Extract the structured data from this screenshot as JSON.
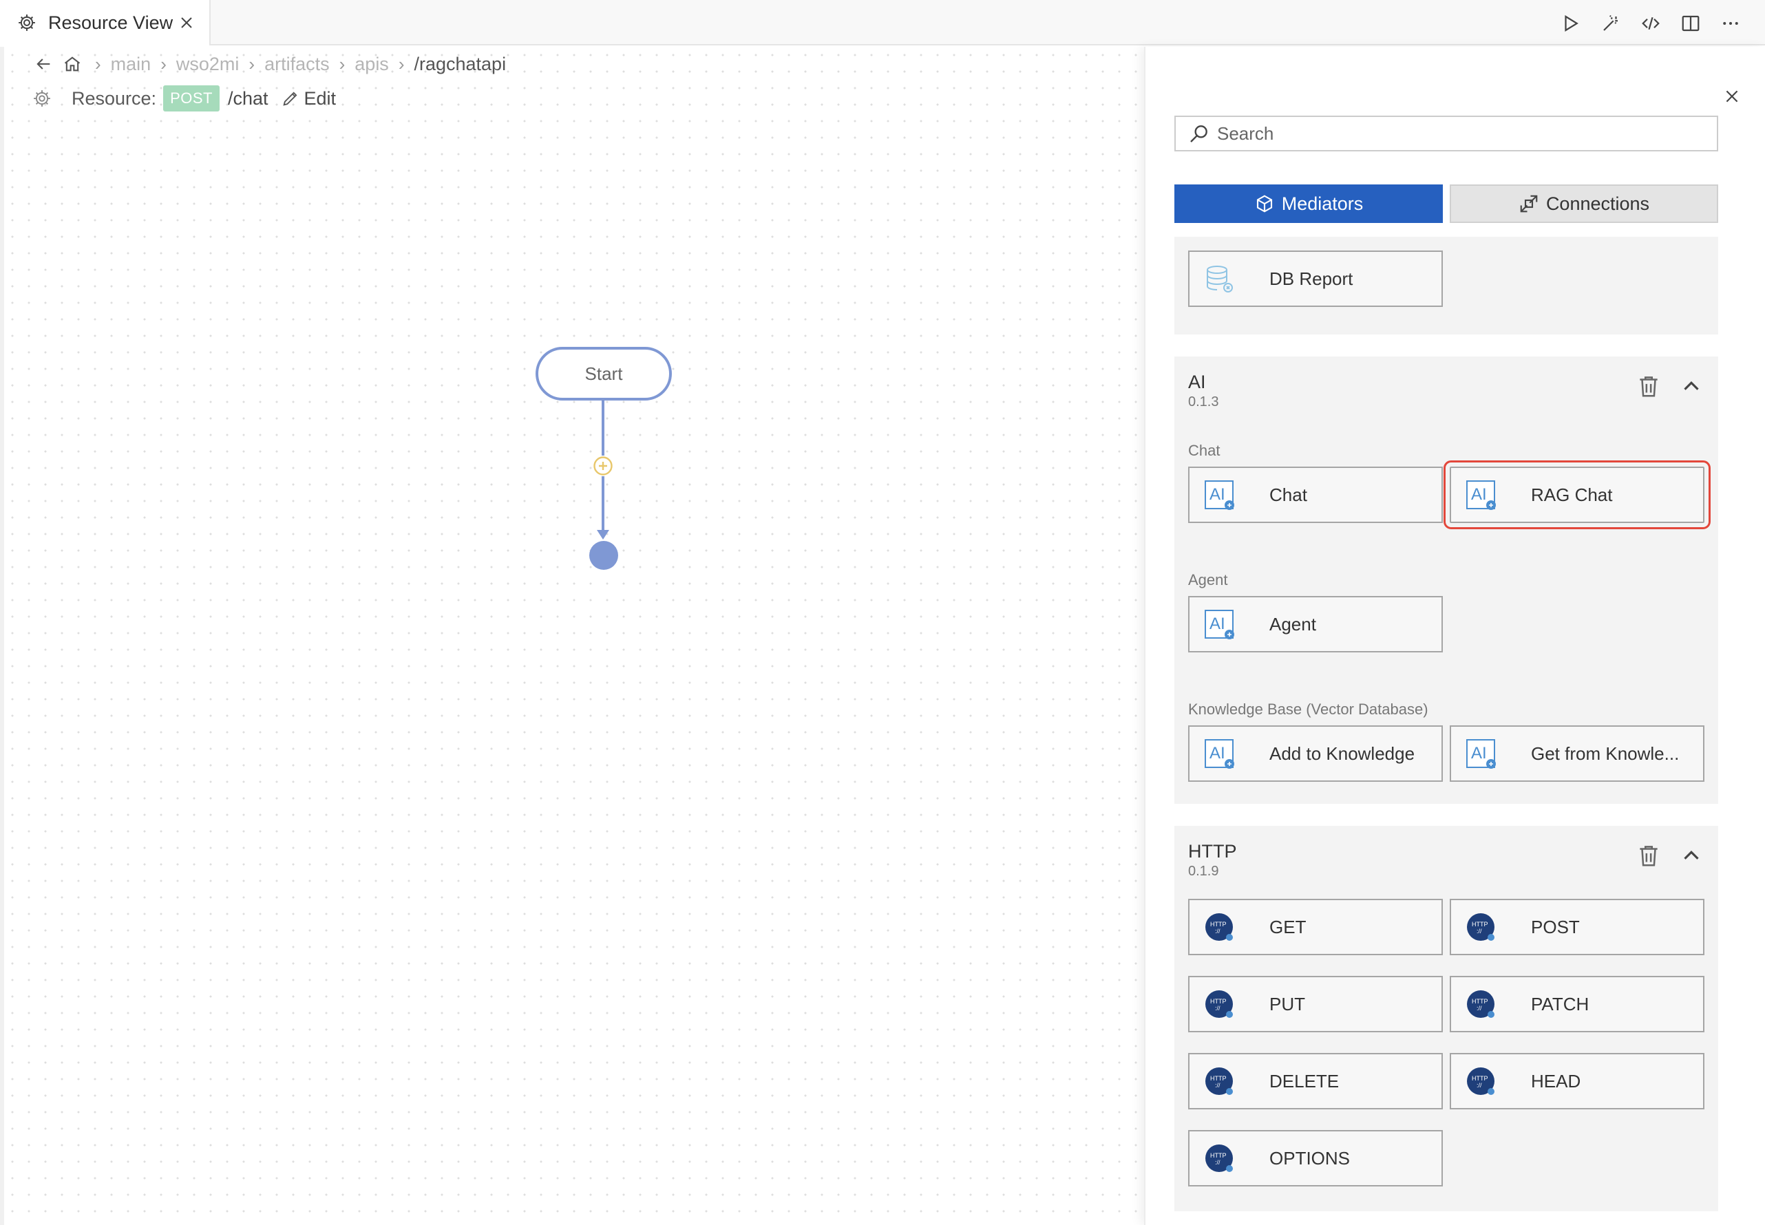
{
  "tab": {
    "label": "Resource View"
  },
  "breadcrumb": {
    "items": [
      "main",
      "wso2mi",
      "artifacts",
      "apis",
      "/ragchatapi"
    ]
  },
  "resource": {
    "label": "Resource:",
    "method": "POST",
    "path": "/chat",
    "edit_label": "Edit"
  },
  "flow": {
    "start_label": "Start"
  },
  "panel": {
    "search_placeholder": "Search",
    "tab_mediators": "Mediators",
    "tab_connections": "Connections",
    "db_section": {
      "cards": [
        "DB Report"
      ]
    },
    "ai_section": {
      "title": "AI",
      "version": "0.1.3",
      "groups": {
        "chat": {
          "label": "Chat",
          "cards": [
            "Chat",
            "RAG Chat"
          ]
        },
        "agent": {
          "label": "Agent",
          "cards": [
            "Agent"
          ]
        },
        "kb": {
          "label": "Knowledge Base (Vector Database)",
          "cards": [
            "Add to Knowledge",
            "Get from Knowle..."
          ]
        }
      }
    },
    "http_section": {
      "title": "HTTP",
      "version": "0.1.9",
      "cards": [
        "GET",
        "POST",
        "PUT",
        "PATCH",
        "DELETE",
        "HEAD",
        "OPTIONS"
      ]
    }
  },
  "colors": {
    "accent": "#2660bf",
    "highlight": "#e3473b",
    "flow": "#7f98d4",
    "post_badge": "#a6dbbb"
  },
  "icons": [
    "gear-icon",
    "close-icon",
    "run-icon",
    "magic-wand-icon",
    "code-icon",
    "split-editor-icon",
    "more-icon",
    "back-arrow-icon",
    "home-icon",
    "pencil-icon",
    "search-icon",
    "cube-icon",
    "connection-icon",
    "database-icon",
    "ai-icon",
    "http-icon",
    "trash-icon",
    "chevron-up-icon",
    "add-circle-icon"
  ]
}
